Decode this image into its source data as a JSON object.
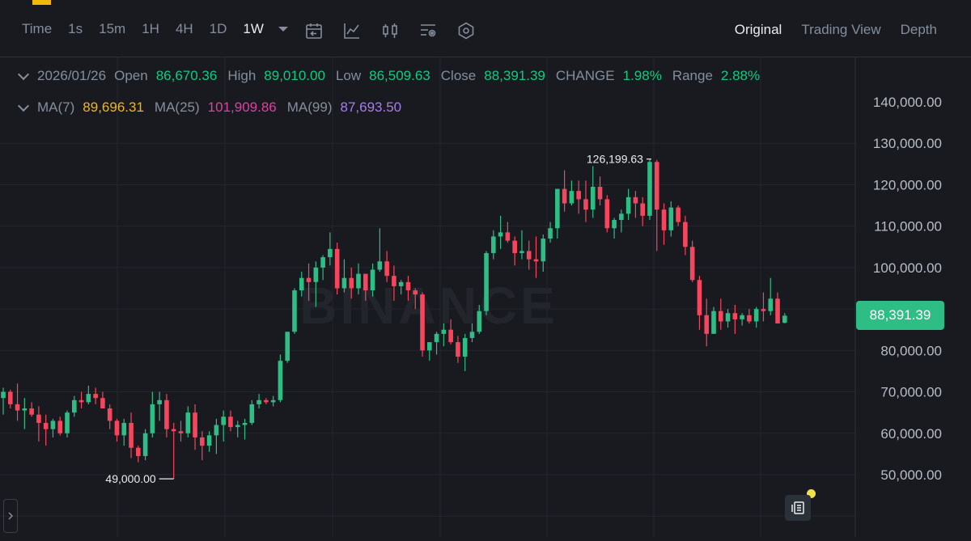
{
  "toolbar": {
    "intervals": [
      "Time",
      "1s",
      "15m",
      "1H",
      "4H",
      "1D",
      "1W"
    ],
    "active_interval": "1W",
    "views": [
      "Original",
      "Trading View",
      "Depth"
    ],
    "active_view": "Original"
  },
  "ohlc": {
    "date": "2026/01/26",
    "open_label": "Open",
    "open": "86,670.36",
    "high_label": "High",
    "high": "89,010.00",
    "low_label": "Low",
    "low": "86,509.63",
    "close_label": "Close",
    "close": "88,391.39",
    "change_label": "CHANGE",
    "change": "1.98%",
    "range_label": "Range",
    "range": "2.88%"
  },
  "ma": {
    "ma7_label": "MA(7)",
    "ma7": "89,696.31",
    "ma25_label": "MA(25)",
    "ma25": "101,909.86",
    "ma99_label": "MA(99)",
    "ma99": "87,693.50"
  },
  "colors": {
    "up": "#2ebd85",
    "down": "#f6465d",
    "ma7": "#f0b90b",
    "ma25": "#e040a0",
    "ma99": "#a77cf2",
    "accent": "#f0b90b"
  },
  "watermark": "BINANCE",
  "current_price": "88,391.39",
  "chart_data": {
    "type": "candlestick",
    "y_ticks": [
      "140,000.00",
      "130,000.00",
      "120,000.00",
      "110,000.00",
      "100,000.00",
      "80,000.00",
      "70,000.00",
      "60,000.00",
      "50,000.00"
    ],
    "ylim": [
      40000,
      143000
    ],
    "max_label": "126,199.63",
    "min_label": "49,000.00",
    "max": 126199.63,
    "min": 49000,
    "candles": [
      [
        68500,
        71000,
        64500,
        70000
      ],
      [
        70000,
        70500,
        66000,
        67000
      ],
      [
        67000,
        72000,
        63000,
        65500
      ],
      [
        65500,
        68500,
        61000,
        66000
      ],
      [
        66000,
        67500,
        64000,
        64500
      ],
      [
        64500,
        66500,
        58000,
        62500
      ],
      [
        62500,
        64500,
        57000,
        61000
      ],
      [
        61000,
        63500,
        59000,
        63000
      ],
      [
        63000,
        64000,
        59500,
        60000
      ],
      [
        60000,
        65500,
        59000,
        65000
      ],
      [
        65000,
        69000,
        64000,
        68000
      ],
      [
        68000,
        70000,
        66000,
        67500
      ],
      [
        67500,
        71500,
        67000,
        69500
      ],
      [
        69500,
        71000,
        67000,
        68500
      ],
      [
        68500,
        70000,
        66500,
        66000
      ],
      [
        66000,
        67000,
        61000,
        63000
      ],
      [
        63000,
        63500,
        58000,
        59500
      ],
      [
        59500,
        63500,
        57000,
        62500
      ],
      [
        62500,
        65000,
        54000,
        56500
      ],
      [
        56500,
        57000,
        53000,
        54500
      ],
      [
        54500,
        61000,
        53500,
        60000
      ],
      [
        60000,
        70000,
        59000,
        67000
      ],
      [
        67000,
        70000,
        63000,
        68000
      ],
      [
        68000,
        69500,
        59000,
        61000
      ],
      [
        61000,
        62500,
        49000,
        60500
      ],
      [
        60500,
        63000,
        58000,
        60000
      ],
      [
        60000,
        66500,
        59000,
        65000
      ],
      [
        65000,
        67000,
        56000,
        59000
      ],
      [
        59000,
        60500,
        53500,
        57000
      ],
      [
        57000,
        60500,
        55500,
        59500
      ],
      [
        59500,
        63500,
        55000,
        62000
      ],
      [
        62000,
        65500,
        58000,
        64000
      ],
      [
        64000,
        65500,
        60500,
        61500
      ],
      [
        61500,
        63000,
        59000,
        62000
      ],
      [
        62000,
        63500,
        58500,
        62500
      ],
      [
        62500,
        68000,
        62000,
        67000
      ],
      [
        67000,
        69500,
        66000,
        68000
      ],
      [
        68000,
        68500,
        67000,
        67500
      ],
      [
        67500,
        69000,
        66500,
        68000
      ],
      [
        68000,
        79000,
        67500,
        77500
      ],
      [
        77500,
        84500,
        77000,
        84500
      ],
      [
        84500,
        95000,
        84000,
        94500
      ],
      [
        94500,
        99000,
        93000,
        97500
      ],
      [
        97500,
        101000,
        92000,
        96500
      ],
      [
        96500,
        101500,
        90500,
        100000
      ],
      [
        100000,
        103000,
        97000,
        102500
      ],
      [
        102500,
        108500,
        100500,
        104500
      ],
      [
        104500,
        106000,
        93500,
        95000
      ],
      [
        95000,
        102000,
        94000,
        97500
      ],
      [
        97500,
        100000,
        92500,
        95000
      ],
      [
        95000,
        101000,
        93500,
        98500
      ],
      [
        98500,
        97500,
        92000,
        94500
      ],
      [
        94500,
        101000,
        93000,
        99500
      ],
      [
        99500,
        109500,
        99000,
        101500
      ],
      [
        101500,
        104000,
        96500,
        98000
      ],
      [
        98000,
        100500,
        92000,
        95500
      ],
      [
        95500,
        97000,
        93500,
        96500
      ],
      [
        96500,
        98000,
        92000,
        94500
      ],
      [
        94500,
        95000,
        90000,
        93500
      ],
      [
        93500,
        94000,
        78500,
        80000
      ],
      [
        80000,
        81500,
        77500,
        82000
      ],
      [
        82000,
        84500,
        79000,
        84000
      ],
      [
        84000,
        86500,
        81000,
        85000
      ],
      [
        85000,
        87500,
        81500,
        82000
      ],
      [
        82000,
        83500,
        77000,
        78500
      ],
      [
        78500,
        84000,
        75000,
        83000
      ],
      [
        83000,
        86500,
        82000,
        84500
      ],
      [
        84500,
        91000,
        84000,
        89500
      ],
      [
        89500,
        104000,
        88500,
        103500
      ],
      [
        103500,
        109000,
        102000,
        107500
      ],
      [
        107500,
        112500,
        104500,
        108500
      ],
      [
        108500,
        111000,
        106000,
        106500
      ],
      [
        106500,
        107500,
        100500,
        103500
      ],
      [
        103500,
        109000,
        102000,
        104000
      ],
      [
        104000,
        106500,
        99500,
        102000
      ],
      [
        102000,
        107500,
        97500,
        101500
      ],
      [
        101500,
        108000,
        99000,
        107000
      ],
      [
        107000,
        111000,
        106000,
        109500
      ],
      [
        109500,
        119000,
        107000,
        119000
      ],
      [
        119000,
        123500,
        113500,
        115500
      ],
      [
        115500,
        121000,
        115000,
        118500
      ],
      [
        118500,
        121000,
        113000,
        116500
      ],
      [
        116500,
        121000,
        111000,
        114000
      ],
      [
        114000,
        124500,
        112000,
        119500
      ],
      [
        119500,
        122000,
        115000,
        116500
      ],
      [
        116500,
        117500,
        108500,
        109500
      ],
      [
        109500,
        112000,
        107000,
        111500
      ],
      [
        111500,
        114000,
        108500,
        113000
      ],
      [
        113000,
        119000,
        111500,
        117000
      ],
      [
        117000,
        118500,
        112000,
        115500
      ],
      [
        115500,
        117000,
        110000,
        112500
      ],
      [
        112500,
        126199.63,
        111500,
        125500
      ],
      [
        125500,
        126000,
        104000,
        114000
      ],
      [
        114000,
        115500,
        105500,
        109000
      ],
      [
        109000,
        116000,
        107500,
        114500
      ],
      [
        114500,
        115000,
        110000,
        111000
      ],
      [
        111000,
        112500,
        103000,
        105000
      ],
      [
        105000,
        106500,
        96500,
        97000
      ],
      [
        97000,
        98000,
        85000,
        88500
      ],
      [
        88500,
        92500,
        81000,
        84000
      ],
      [
        84000,
        90500,
        84500,
        89500
      ],
      [
        89500,
        92500,
        85000,
        87000
      ],
      [
        87000,
        90000,
        85500,
        89000
      ],
      [
        89000,
        91000,
        84000,
        87500
      ],
      [
        87500,
        89000,
        86000,
        88500
      ],
      [
        88500,
        90000,
        86500,
        87000
      ],
      [
        87000,
        90500,
        85500,
        90000
      ],
      [
        90000,
        94000,
        87000,
        89500
      ],
      [
        89500,
        97500,
        88500,
        92500
      ],
      [
        92500,
        94000,
        86500,
        86500
      ],
      [
        86670.36,
        89010,
        86509.63,
        88391.39
      ]
    ]
  }
}
